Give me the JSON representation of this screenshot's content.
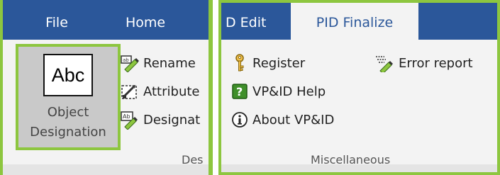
{
  "tabs": [
    {
      "label": "File",
      "active": false
    },
    {
      "label": "Home",
      "active": false
    },
    {
      "label": "D Edit",
      "active": false
    },
    {
      "label": "PID Finalize",
      "active": true
    }
  ],
  "design_group": {
    "big_button": {
      "icon_text": "Abc",
      "label_line1": "Object",
      "label_line2": "Designation"
    },
    "items": [
      {
        "label": "Rename",
        "icon": "rename-icon"
      },
      {
        "label": "Attribute",
        "icon": "attribute-icon"
      },
      {
        "label": "Designat",
        "icon": "designation-icon"
      }
    ],
    "group_label": "Des"
  },
  "misc_group": {
    "items": [
      {
        "label": "Register",
        "icon": "key-icon"
      },
      {
        "label": "VP&ID Help",
        "icon": "help-icon"
      },
      {
        "label": "About VP&ID",
        "icon": "info-icon"
      },
      {
        "label": "Error report",
        "icon": "error-report-icon"
      }
    ],
    "group_label": "Miscellaneous"
  },
  "colors": {
    "tab_bar": "#2b579a",
    "highlight": "#8dc63f",
    "ribbon_bg": "#f3f3f3"
  }
}
